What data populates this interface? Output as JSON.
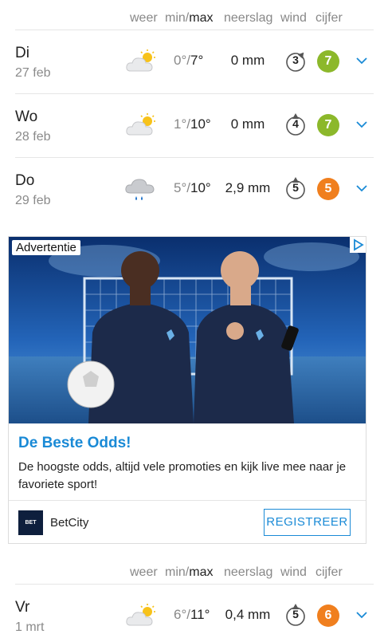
{
  "columns": {
    "weer": "weer",
    "min": "min/",
    "max": "max",
    "neerslag": "neerslag",
    "wind": "wind",
    "cijfer": "cijfer"
  },
  "days": [
    {
      "name": "Di",
      "date": "27 feb",
      "icon": "partly-cloudy-icon",
      "min": "0°/",
      "max": "7°",
      "rain": "0 mm",
      "wind": "3",
      "grade": "7",
      "grade_color": "#8cb82b"
    },
    {
      "name": "Wo",
      "date": "28 feb",
      "icon": "partly-cloudy-icon",
      "min": "1°/",
      "max": "10°",
      "rain": "0 mm",
      "wind": "4",
      "grade": "7",
      "grade_color": "#8cb82b"
    },
    {
      "name": "Do",
      "date": "29 feb",
      "icon": "rain-cloud-icon",
      "min": "5°/",
      "max": "10°",
      "rain": "2,9 mm",
      "wind": "5",
      "grade": "5",
      "grade_color": "#f07f1e"
    },
    {
      "name": "Vr",
      "date": "1 mrt",
      "icon": "partly-cloudy-icon",
      "min": "6°/",
      "max": "11°",
      "rain": "0,4 mm",
      "wind": "5",
      "grade": "6",
      "grade_color": "#f07f1e"
    }
  ],
  "ad": {
    "label": "Advertentie",
    "title": "De Beste Odds!",
    "body": "De hoogste odds, altijd vele promoties en kijk live mee naar je favoriete sport!",
    "brand": "BetCity",
    "logo_text": "BET CITY",
    "cta": "REGISTREER",
    "accent": "#1a8ad6"
  }
}
